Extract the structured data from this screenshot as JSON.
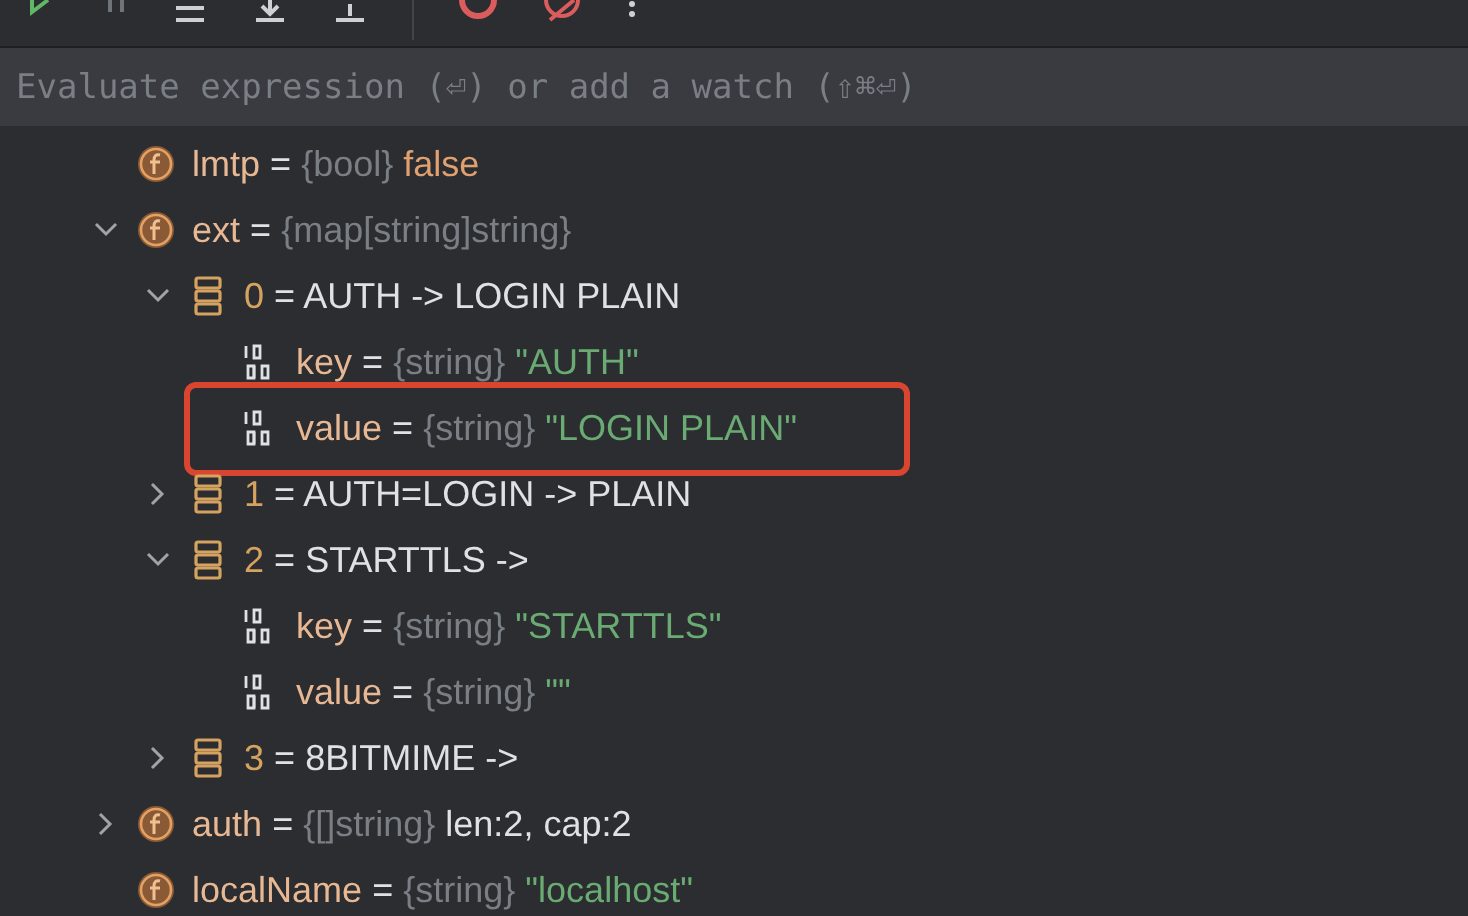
{
  "watch_field": {
    "placeholder": "Evaluate expression (⏎) or add a watch (⇧⌘⏎)"
  },
  "variables": [
    {
      "kind": "field",
      "name": "lmtp",
      "operator": "=",
      "type": "{bool}",
      "keyword_value": "false",
      "highlighted": false
    },
    {
      "kind": "field",
      "name": "ext",
      "operator": "=",
      "type": "{map[string]string}",
      "expanded": true,
      "highlighted": false,
      "children": [
        {
          "kind": "entry",
          "name": "0",
          "operator": "=",
          "value": "AUTH -> LOGIN PLAIN",
          "expanded": true,
          "highlighted": false,
          "children": [
            {
              "kind": "scalar",
              "name": "key",
              "operator": "=",
              "type": "{string}",
              "string_value": "\"AUTH\"",
              "highlighted": false
            },
            {
              "kind": "scalar",
              "name": "value",
              "operator": "=",
              "type": "{string}",
              "string_value": "\"LOGIN PLAIN\"",
              "highlighted": true
            }
          ]
        },
        {
          "kind": "entry",
          "name": "1",
          "operator": "=",
          "value": "AUTH=LOGIN -> PLAIN",
          "expanded": false,
          "highlighted": false
        },
        {
          "kind": "entry",
          "name": "2",
          "operator": "=",
          "value": "STARTTLS ->",
          "expanded": true,
          "highlighted": false,
          "children": [
            {
              "kind": "scalar",
              "name": "key",
              "operator": "=",
              "type": "{string}",
              "string_value": "\"STARTTLS\"",
              "highlighted": false
            },
            {
              "kind": "scalar",
              "name": "value",
              "operator": "=",
              "type": "{string}",
              "string_value": "\"\"",
              "highlighted": false
            }
          ]
        },
        {
          "kind": "entry",
          "name": "3",
          "operator": "=",
          "value": "8BITMIME ->",
          "expanded": false,
          "highlighted": false
        }
      ]
    },
    {
      "kind": "field",
      "name": "auth",
      "operator": "=",
      "type": "{[]string}",
      "value": "len:2, cap:2",
      "expanded": false,
      "highlighted": false
    },
    {
      "kind": "field",
      "name": "localName",
      "operator": "=",
      "type": "{string}",
      "string_value": "\"localhost\"",
      "highlighted": false
    }
  ]
}
